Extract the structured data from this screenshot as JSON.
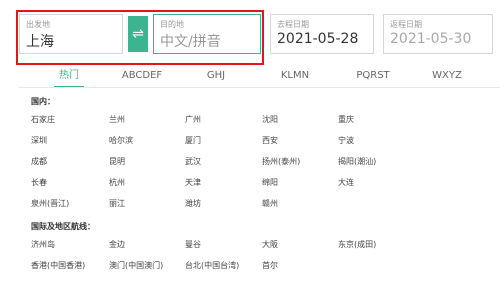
{
  "search": {
    "depart_label": "出发地",
    "depart_value": "上海",
    "swap_icon": "⇌",
    "dest_label": "目的地",
    "dest_placeholder": "中文/拼音",
    "depart_date_label": "去程日期",
    "depart_date_value": "2021-05-28",
    "return_date_label": "返程日期",
    "return_date_value": "2021-05-30"
  },
  "tabs": [
    {
      "label": "热门",
      "active": true
    },
    {
      "label": "ABCDEF",
      "active": false
    },
    {
      "label": "GHJ",
      "active": false
    },
    {
      "label": "KLMN",
      "active": false
    },
    {
      "label": "PQRST",
      "active": false
    },
    {
      "label": "WXYZ",
      "active": false
    }
  ],
  "domestic": {
    "title": "国内：",
    "rows": [
      [
        "石家庄",
        "兰州",
        "广州",
        "沈阳",
        "重庆"
      ],
      [
        "深圳",
        "哈尔滨",
        "厦门",
        "西安",
        "宁波"
      ],
      [
        "成都",
        "昆明",
        "武汉",
        "扬州(泰州)",
        "揭阳(潮汕)"
      ],
      [
        "长春",
        "杭州",
        "天津",
        "绵阳",
        "大连"
      ],
      [
        "泉州(晋江)",
        "丽江",
        "潍坊",
        "赣州",
        ""
      ]
    ]
  },
  "international": {
    "title": "国际及地区航线：",
    "rows": [
      [
        "济州岛",
        "金边",
        "曼谷",
        "大阪",
        "东京(成田)"
      ],
      [
        "香港(中国香港)",
        "澳门(中国澳门)",
        "台北(中国台湾)",
        "首尔",
        ""
      ]
    ]
  },
  "colors": {
    "accent": "#3cb48f",
    "highlight_frame": "#e3141e"
  }
}
